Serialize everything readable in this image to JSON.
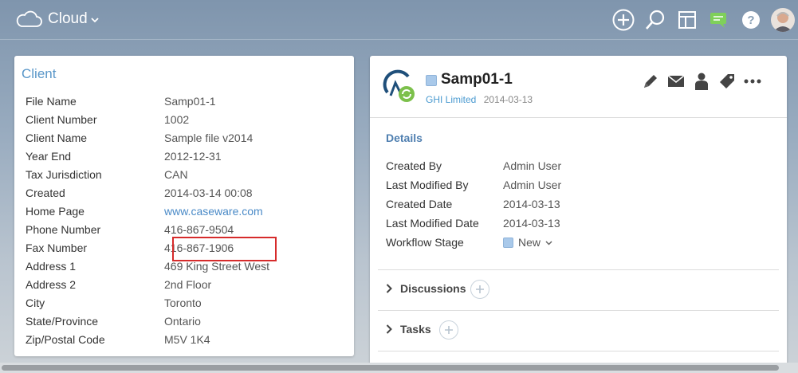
{
  "topbar": {
    "brand": "Cloud",
    "icons": [
      "plus-circle-icon",
      "search-icon",
      "layout-icon",
      "chat-icon",
      "help-icon",
      "user-avatar"
    ]
  },
  "client": {
    "title": "Client",
    "rows": [
      {
        "label": "File Name",
        "value": "Samp01-1"
      },
      {
        "label": "Client Number",
        "value": "1002"
      },
      {
        "label": "Client Name",
        "value": "Sample file v2014"
      },
      {
        "label": "Year End",
        "value": "2012-12-31"
      },
      {
        "label": "Tax Jurisdiction",
        "value": "CAN"
      },
      {
        "label": "Created",
        "value": "2014-03-14 00:08"
      },
      {
        "label": "Home Page",
        "value": "www.caseware.com"
      },
      {
        "label": "Phone Number",
        "value": "416-867-9504"
      },
      {
        "label": "Fax Number",
        "value": "416-867-1906"
      },
      {
        "label": "Address 1",
        "value": "469 King Street West"
      },
      {
        "label": "Address 2",
        "value": "2nd Floor"
      },
      {
        "label": "City",
        "value": "Toronto"
      },
      {
        "label": "State/Province",
        "value": "Ontario"
      },
      {
        "label": "Zip/Postal Code",
        "value": "M5V 1K4"
      }
    ]
  },
  "entity": {
    "title": "Samp01-1",
    "company": "GHI Limited",
    "date": "2014-03-13",
    "actions": [
      "edit-icon",
      "mail-icon",
      "person-icon",
      "tag-icon",
      "more-icon"
    ],
    "details_title": "Details",
    "details": [
      {
        "label": "Created By",
        "value": "Admin User"
      },
      {
        "label": "Last Modified By",
        "value": "Admin User"
      },
      {
        "label": "Created Date",
        "value": "2014-03-13"
      },
      {
        "label": "Last Modified Date",
        "value": "2014-03-13"
      },
      {
        "label": "Workflow Stage",
        "value": "New"
      }
    ],
    "sections": [
      {
        "label": "Discussions"
      },
      {
        "label": "Tasks"
      }
    ]
  },
  "colors": {
    "accent": "#5a97c9",
    "highlight": "#d62b2b",
    "link": "#4a8ac7"
  }
}
